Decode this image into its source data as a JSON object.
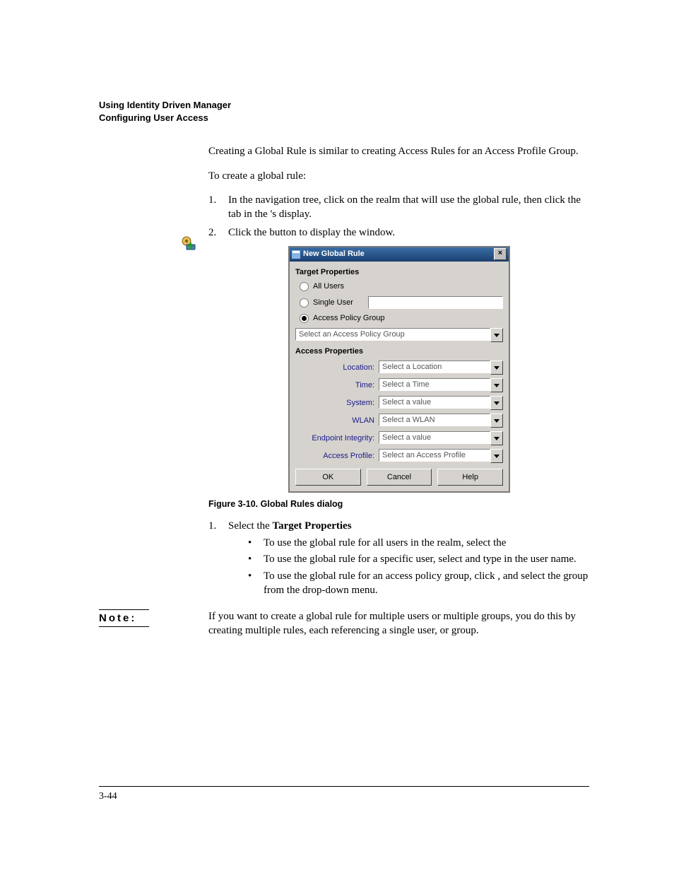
{
  "header": {
    "line1": "Using Identity Driven Manager",
    "line2": "Configuring User Access"
  },
  "intro": " Creating a Global Rule is similar to creating Access Rules for an Access Profile Group.",
  "lead": "To create a global rule:",
  "steps1": [
    {
      "n": "1.",
      "t": "In the navigation tree, click on the realm that will use the global rule, then click the                     tab in the          's display."
    },
    {
      "n": "2.",
      "t": "Click the                         button to display the                              window."
    }
  ],
  "dialog": {
    "title": "New Global Rule",
    "close": "×",
    "group1": "Target Properties",
    "radios": {
      "all": "All Users",
      "single": "Single User",
      "apg": "Access Policy Group"
    },
    "apg_drop": "Select an Access Policy Group",
    "group2": "Access Properties",
    "props": [
      {
        "label": "Location:",
        "value": "Select a Location"
      },
      {
        "label": "Time:",
        "value": "Select a Time"
      },
      {
        "label": "System:",
        "value": "Select a value"
      },
      {
        "label": "WLAN",
        "value": "Select a WLAN"
      },
      {
        "label": "Endpoint Integrity:",
        "value": "Select a value"
      },
      {
        "label": "Access Profile:",
        "value": "Select an Access Profile"
      }
    ],
    "buttons": {
      "ok": "OK",
      "cancel": "Cancel",
      "help": "Help"
    }
  },
  "figcap": "Figure 3-10. Global Rules dialog",
  "steps2_n": "1.",
  "steps2_lead_a": "Select the ",
  "steps2_lead_b": "Target Properties",
  "bullets": [
    "To use the global rule for all users in the realm, select the",
    "To use the global rule for a specific user, select                  and type in the user name.",
    "To use the global rule for an access policy group, click                         , and select the group from the drop-down menu."
  ],
  "note": {
    "label": "Note:",
    "text": "If you want to create a global rule for multiple users or multiple groups, you do this by creating multiple rules, each referencing a single user, or group."
  },
  "pagenum": "3-44"
}
